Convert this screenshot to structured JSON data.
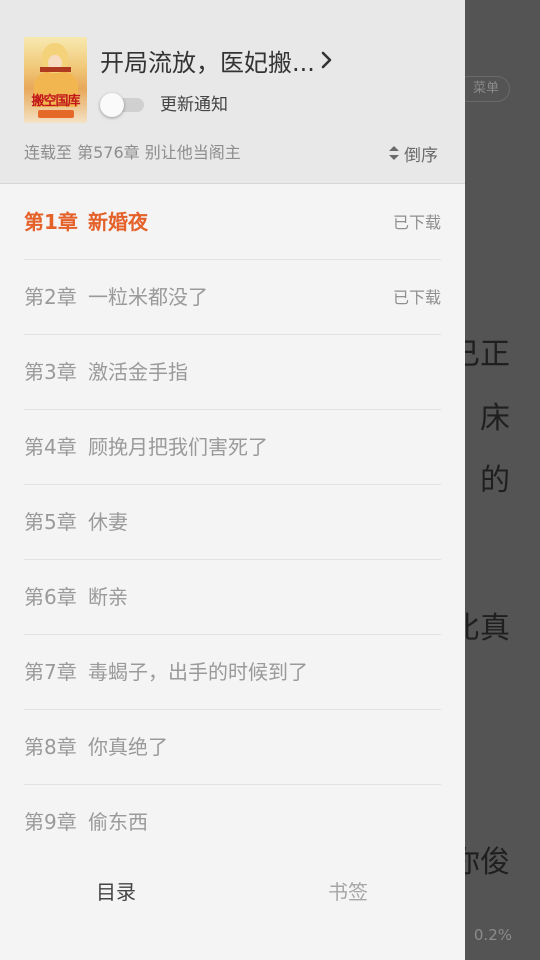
{
  "reader": {
    "menu_chip": "菜单",
    "lines": [
      "已正",
      "床",
      "的",
      "比真",
      "你俊"
    ],
    "percent": "0.2%"
  },
  "drawer": {
    "book_title": "开局流放，医妃搬...",
    "notify_label": "更新通知",
    "notify_on": false,
    "progress_text": "连载至 第576章 别让他当阁主",
    "sort_label": "倒序",
    "accent_color": "#e5612a",
    "chapters": [
      {
        "num": "第1章",
        "name": "新婚夜",
        "status": "已下载",
        "active": true
      },
      {
        "num": "第2章",
        "name": "一粒米都没了",
        "status": "已下载",
        "active": false
      },
      {
        "num": "第3章",
        "name": "激活金手指",
        "status": "",
        "active": false
      },
      {
        "num": "第4章",
        "name": "顾挽月把我们害死了",
        "status": "",
        "active": false
      },
      {
        "num": "第5章",
        "name": "休妻",
        "status": "",
        "active": false
      },
      {
        "num": "第6章",
        "name": "断亲",
        "status": "",
        "active": false
      },
      {
        "num": "第7章",
        "name": "毒蝎子，出手的时候到了",
        "status": "",
        "active": false
      },
      {
        "num": "第8章",
        "name": "你真绝了",
        "status": "",
        "active": false
      },
      {
        "num": "第9章",
        "name": "偷东西",
        "status": "",
        "active": false
      }
    ],
    "tabs": {
      "catalog": "目录",
      "bookmark": "书签"
    },
    "cover_title": "搬空国库",
    "icons": {
      "title_chevron": "chevron-right-icon",
      "sort": "sort-icon"
    }
  }
}
